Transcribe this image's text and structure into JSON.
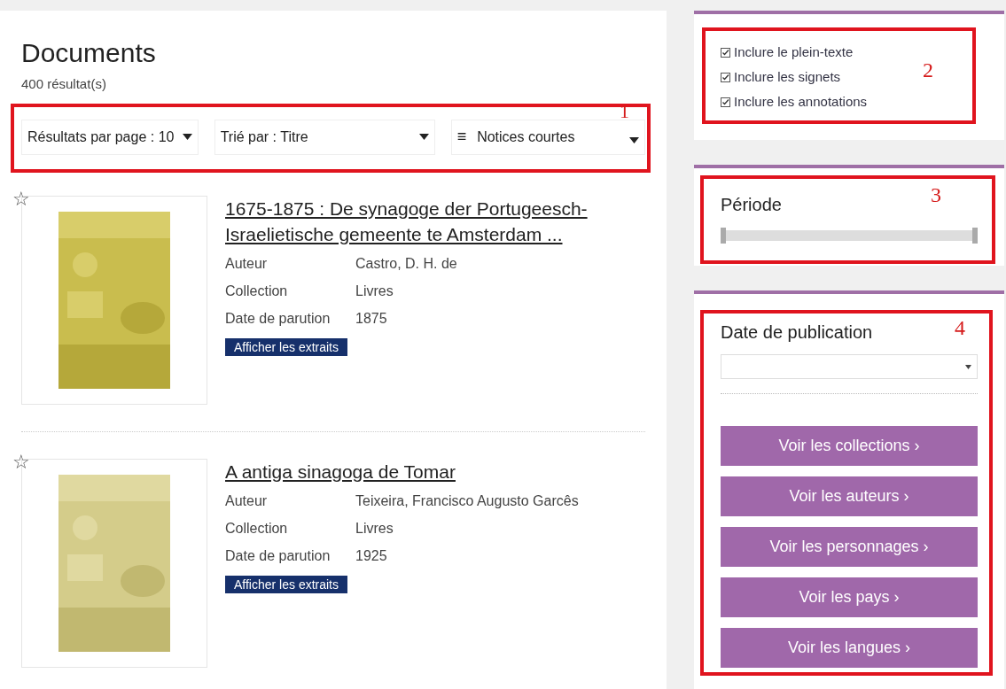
{
  "main": {
    "title": "Documents",
    "count": "400 résultat(s)",
    "toolbar": [
      {
        "kind": "select",
        "label": "Résultats par page : 10"
      },
      {
        "kind": "select",
        "label": "Trié par : Titre"
      },
      {
        "kind": "view",
        "label": "Notices courtes",
        "icon": "≡"
      }
    ]
  },
  "results": [
    {
      "title": "1675-1875 : De synagoge der Portugeesch-Israelietische gemeente te Amsterdam ...",
      "fields": [
        {
          "label": "Auteur",
          "value": "Castro, D. H. de"
        },
        {
          "label": "Collection",
          "value": "Livres"
        },
        {
          "label": "Date de parution",
          "value": "1875"
        }
      ],
      "button": "Afficher les extraits",
      "star": "☆"
    },
    {
      "title": "A antiga sinagoga de Tomar",
      "fields": [
        {
          "label": "Auteur",
          "value": "Teixeira, Francisco Augusto Garcês"
        },
        {
          "label": "Collection",
          "value": "Livres"
        },
        {
          "label": "Date de parution",
          "value": "1925"
        }
      ],
      "button": "Afficher les extraits",
      "star": "☆"
    }
  ],
  "sidebar": {
    "options": [
      {
        "label": "Inclure le plein-texte",
        "checked": true
      },
      {
        "label": "Inclure les signets",
        "checked": true
      },
      {
        "label": "Inclure les annotations",
        "checked": true
      }
    ],
    "period": {
      "title": "Période",
      "level": 1
    },
    "publication": {
      "title": "Date de publication",
      "links": [
        "Voir les collections",
        "Voir les auteurs",
        "Voir les personnages",
        "Voir les pays",
        "Voir les langues"
      ],
      "chevron": "›"
    }
  },
  "annotations": [
    "1",
    "2",
    "3",
    "4"
  ]
}
